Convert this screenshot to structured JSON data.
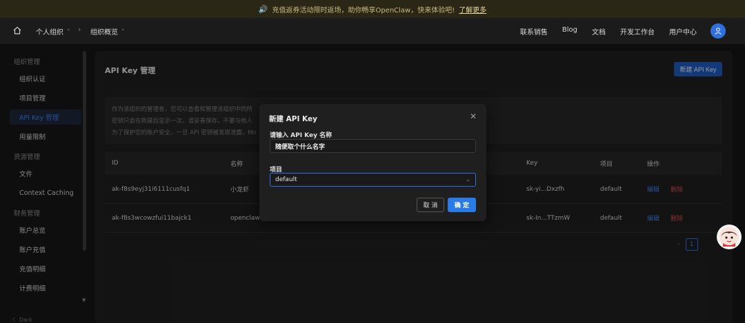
{
  "banner": {
    "text": "充值返券活动限时返场，助你畅享OpenClaw，快来体验吧!",
    "link": "了解更多"
  },
  "topnav": {
    "org": "个人组织",
    "section": "组织概览",
    "links": [
      "联系销售",
      "Blog",
      "文档",
      "开发工作台",
      "用户中心"
    ]
  },
  "sidebar": {
    "groups": [
      {
        "title": "组织管理",
        "items": [
          "组织认证",
          "项目管理",
          "API Key 管理",
          "用量限制"
        ]
      },
      {
        "title": "资源管理",
        "items": [
          "文件",
          "Context Caching"
        ]
      },
      {
        "title": "财务管理",
        "items": [
          "账户总览",
          "账户充值",
          "充值明细",
          "计费明细"
        ]
      }
    ],
    "active": "API Key 管理",
    "footer": "Dark"
  },
  "main": {
    "title": "API Key 管理",
    "new_button": "新建 API Key",
    "notice_lines": [
      "作为该组织的管理者，您可以查看和管理该组织中的所",
      "密钥只会在新建后显示一次，请妥善保存。不要与他人",
      "为了保护您的账户安全，一旦 API 密钥被发现泄露，Mo"
    ],
    "columns": [
      "ID",
      "名称",
      "Key",
      "项目",
      "操作"
    ],
    "rows": [
      {
        "id": "ak-f8s9eyj31i6111cusfq1",
        "name": "小龙虾",
        "key": "sk-yi...Dxzfh",
        "project": "default"
      },
      {
        "id": "ak-f8s3wcowzfui11bajck1",
        "name": "openclaw4",
        "key": "sk-In...TTzmW",
        "project": "default"
      }
    ],
    "edit_label": "编辑",
    "delete_label": "删除",
    "pager": {
      "prev": "‹",
      "current": "1"
    }
  },
  "modal": {
    "title": "新建 API Key",
    "name_label": "请输入 API Key 名称",
    "name_value": "随便取个什么名字",
    "project_label": "项目",
    "project_value": "default",
    "cancel": "取 消",
    "ok": "确 定"
  },
  "colors": {
    "accent": "#2a7be6",
    "danger": "#d04a4a",
    "banner_text": "#c9b87e"
  }
}
